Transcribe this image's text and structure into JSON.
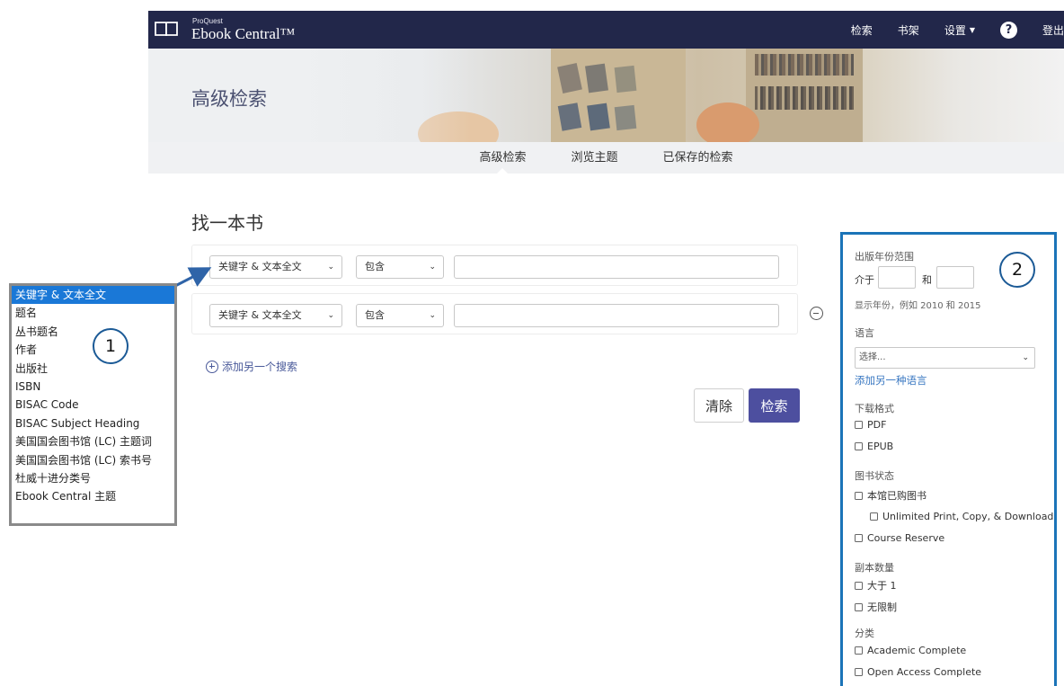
{
  "header": {
    "brand_small": "ProQuest",
    "brand_big": "Ebook Central™",
    "nav": [
      "检索",
      "书架",
      "设置",
      "登出"
    ],
    "help_glyph": "?"
  },
  "banner": {
    "title": "高级检索"
  },
  "subnav": {
    "tabs": [
      "高级检索",
      "浏览主题",
      "已保存的检索"
    ],
    "active": "高级检索"
  },
  "form": {
    "heading": "找一本书",
    "rows": [
      {
        "field": "关键字 & 文本全文",
        "operator": "包含",
        "value": ""
      },
      {
        "field": "关键字 & 文本全文",
        "operator": "包含",
        "value": ""
      }
    ],
    "add_label": "添加另一个搜索",
    "clear_label": "清除",
    "search_label": "检索"
  },
  "field_dropdown": {
    "callout": "1",
    "selected": "关键字 & 文本全文",
    "options": [
      "关键字 & 文本全文",
      "题名",
      "丛书题名",
      "作者",
      "出版社",
      "ISBN",
      "BISAC Code",
      "BISAC Subject Heading",
      "美国国会图书馆 (LC) 主题词",
      "美国国会图书馆 (LC) 索书号",
      "杜威十进分类号",
      "Ebook Central 主题"
    ]
  },
  "filters": {
    "callout": "2",
    "year_range": {
      "label": "出版年份范围",
      "between": "介于",
      "and": "和",
      "hint": "显示年份，例如 2010 和 2015"
    },
    "language": {
      "label": "语言",
      "placeholder": "选择...",
      "add_link": "添加另一种语言"
    },
    "format": {
      "label": "下载格式",
      "options": [
        "PDF",
        "EPUB"
      ]
    },
    "status": {
      "label": "图书状态",
      "options": [
        "本馆已购图书",
        "Unlimited Print, Copy, & Download",
        "Course Reserve"
      ]
    },
    "copies": {
      "label": "副本数量",
      "options": [
        "大于 1",
        "无限制"
      ]
    },
    "category": {
      "label": "分类",
      "options": [
        "Academic Complete",
        "Open Access Complete"
      ]
    }
  },
  "colors": {
    "topbar": "#22274a",
    "accent_button": "#4d4f9f",
    "callout_border": "#1b74b8",
    "selected_option": "#1a78d7",
    "link": "#3a78c2"
  }
}
